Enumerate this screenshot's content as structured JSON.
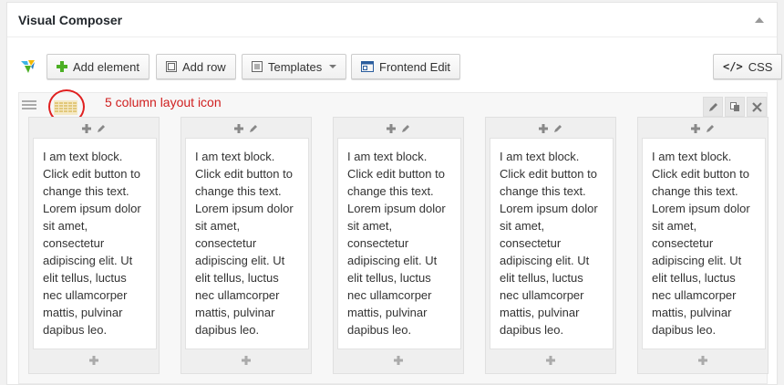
{
  "panel": {
    "title": "Visual Composer"
  },
  "toolbar": {
    "add_element": "Add element",
    "add_row": "Add row",
    "templates": "Templates",
    "frontend_edit": "Frontend Edit",
    "css": "CSS"
  },
  "annotation": "5 column layout icon",
  "columns": [
    {
      "text": "I am text block. Click edit button to change this text. Lorem ipsum dolor sit amet, consectetur adipiscing elit. Ut elit tellus, luctus nec ullamcorper mattis, pulvinar dapibus leo."
    },
    {
      "text": "I am text block. Click edit button to change this text. Lorem ipsum dolor sit amet, consectetur adipiscing elit. Ut elit tellus, luctus nec ullamcorper mattis, pulvinar dapibus leo."
    },
    {
      "text": "I am text block. Click edit button to change this text. Lorem ipsum dolor sit amet, consectetur adipiscing elit. Ut elit tellus, luctus nec ullamcorper mattis, pulvinar dapibus leo."
    },
    {
      "text": "I am text block. Click edit button to change this text. Lorem ipsum dolor sit amet, consectetur adipiscing elit. Ut elit tellus, luctus nec ullamcorper mattis, pulvinar dapibus leo."
    },
    {
      "text": "I am text block. Click edit button to change this text. Lorem ipsum dolor sit amet, consectetur adipiscing elit. Ut elit tellus, luctus nec ullamcorper mattis, pulvinar dapibus leo."
    }
  ],
  "icons": {
    "logo": "vc-logo-icon",
    "add_element": "plus-icon",
    "add_row": "row-icon",
    "templates": "templates-icon",
    "frontend_edit": "frontend-icon",
    "css": "code-icon",
    "row_handle": "drag-handle-icon",
    "layout": "five-column-layout-icon",
    "row_edit": "pencil-icon",
    "row_clone": "clone-icon",
    "row_delete": "close-icon"
  },
  "colors": {
    "accent_green": "#4caf25",
    "annotation_red": "#d02020",
    "layout_icon": "#e2c87a"
  }
}
